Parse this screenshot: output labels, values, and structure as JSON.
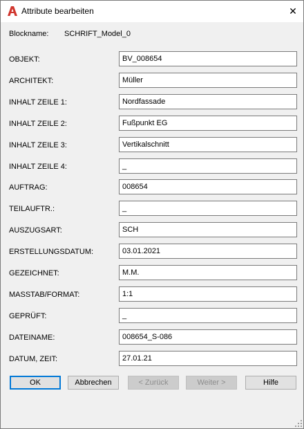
{
  "window": {
    "title": "Attribute bearbeiten",
    "icon": "autocad-a-icon",
    "close_glyph": "✕"
  },
  "block": {
    "label": "Blockname:",
    "value": "SCHRIFT_Model_0"
  },
  "attributes": [
    {
      "label": "OBJEKT:",
      "value": "BV_008654"
    },
    {
      "label": "ARCHITEKT:",
      "value": "Müller"
    },
    {
      "label": "INHALT ZEILE 1:",
      "value": "Nordfassade"
    },
    {
      "label": "INHALT ZEILE 2:",
      "value": "Fußpunkt EG"
    },
    {
      "label": "INHALT ZEILE 3:",
      "value": "Vertikalschnitt"
    },
    {
      "label": "INHALT ZEILE 4:",
      "value": "_"
    },
    {
      "label": "AUFTRAG:",
      "value": "008654"
    },
    {
      "label": "TEILAUFTR.:",
      "value": "_"
    },
    {
      "label": "AUSZUGSART:",
      "value": "SCH"
    },
    {
      "label": "ERSTELLUNGSDATUM:",
      "value": "03.01.2021"
    },
    {
      "label": "GEZEICHNET:",
      "value": "M.M."
    },
    {
      "label": "MASSTAB/FORMAT:",
      "value": "1:1"
    },
    {
      "label": "GEPRÜFT:",
      "value": "_"
    },
    {
      "label": "DATEINAME:",
      "value": "008654_S-086"
    },
    {
      "label": "DATUM, ZEIT:",
      "value": "27.01.21"
    }
  ],
  "buttons": {
    "ok": "OK",
    "cancel": "Abbrechen",
    "back": "< Zurück",
    "next": "Weiter >",
    "help": "Hilfe"
  },
  "colors": {
    "accent": "#0078d7",
    "app_icon_red": "#d0342c"
  }
}
